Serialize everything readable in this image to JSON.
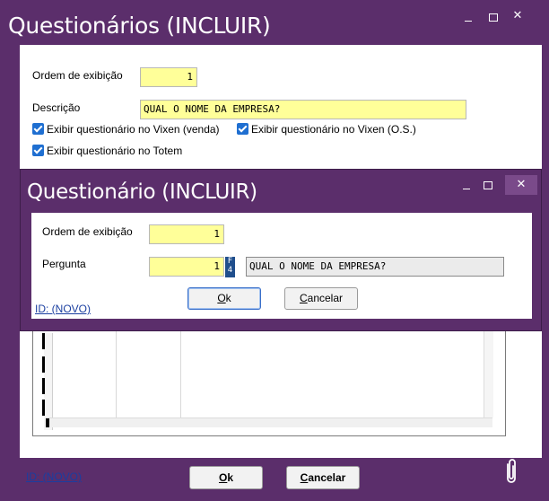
{
  "outer_window": {
    "title": "Questionários (INCLUIR)",
    "controls": {
      "minimize": "",
      "maximize": "",
      "close": "✕"
    },
    "form": {
      "ordem_label": "Ordem de exibição",
      "ordem_value": "1",
      "descricao_label": "Descrição",
      "descricao_value": "QUAL O NOME DA EMPRESA?",
      "checkboxes": [
        {
          "label": "Exibir questionário no Vixen (venda)",
          "checked": true
        },
        {
          "label": "Exibir questionário no Vixen (O.S.)",
          "checked": true
        },
        {
          "label": "Exibir questionário no Totem",
          "checked": true
        }
      ]
    },
    "footer": {
      "id_link": "ID: (NOVO)",
      "ok_label_prefix": "",
      "ok_mnemonic": "O",
      "ok_label_suffix": "k",
      "cancel_mnemonic": "C",
      "cancel_label_suffix": "ancelar",
      "attach_icon": "paperclip-icon"
    }
  },
  "inner_dialog": {
    "title": "Questionário (INCLUIR)",
    "controls": {
      "minimize": "",
      "maximize": "",
      "close": "✕"
    },
    "ordem_label": "Ordem de exibição",
    "ordem_value": "1",
    "pergunta_label": "Pergunta",
    "pergunta_value": "1",
    "f4_key": "F4",
    "pergunta_text": "QUAL O NOME DA EMPRESA?",
    "ok_mnemonic": "O",
    "ok_label_suffix": "k",
    "cancel_mnemonic": "C",
    "cancel_label_suffix": "ancelar",
    "id_link": "ID: (NOVO)"
  },
  "colors": {
    "window_frame": "#5b2e6b",
    "input_yellow": "#ffff99",
    "checkbox_blue": "#1f6fd1",
    "link_blue": "#1a3ea0"
  }
}
